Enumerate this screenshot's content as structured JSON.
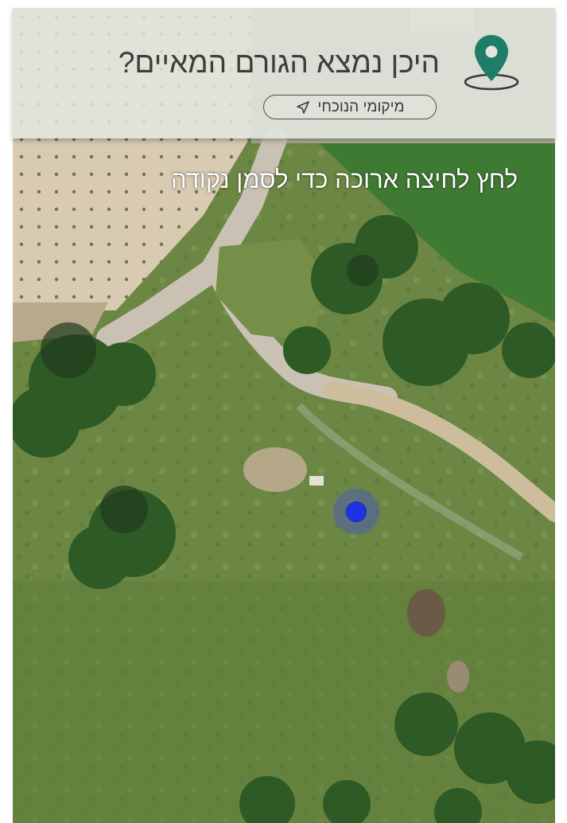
{
  "header": {
    "title": "היכן נמצא הגורם המאיים?",
    "location_button_label": "מיקומי הנוכחי",
    "pin_icon": "location-pin-icon",
    "arrow_icon": "navigation-arrow-icon"
  },
  "map": {
    "hint": "לחץ לחיצה ארוכה כדי לסמן נקודה",
    "view": "satellite"
  },
  "colors": {
    "pin": "#1e7d68",
    "user_dot": "#2132e6",
    "user_halo": "#5a62cf"
  }
}
